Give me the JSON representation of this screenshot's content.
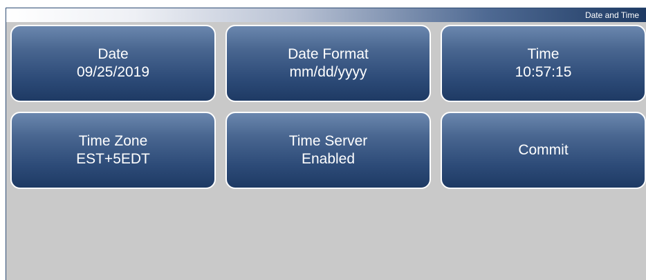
{
  "header": {
    "title": "Date and Time"
  },
  "buttons": {
    "date": {
      "label": "Date",
      "value": "09/25/2019"
    },
    "date_format": {
      "label": "Date Format",
      "value": "mm/dd/yyyy"
    },
    "time": {
      "label": "Time",
      "value": "10:57:15"
    },
    "time_zone": {
      "label": "Time Zone",
      "value": "EST+5EDT"
    },
    "time_server": {
      "label": "Time Server",
      "value": "Enabled"
    },
    "commit": {
      "label": "Commit"
    }
  },
  "colors": {
    "button_top": "#6b87ae",
    "button_bottom": "#1e3a64",
    "background": "#c9c9c9",
    "titlebar_dark": "#1e3a63"
  }
}
